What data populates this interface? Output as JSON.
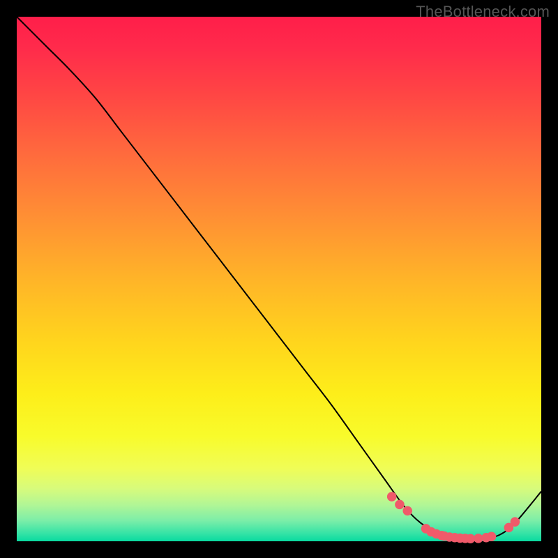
{
  "watermark": "TheBottleneck.com",
  "chart_data": {
    "type": "line",
    "title": "",
    "xlabel": "",
    "ylabel": "",
    "xlim": [
      0,
      100
    ],
    "ylim": [
      0,
      100
    ],
    "curve": {
      "x": [
        0,
        3,
        6,
        10,
        15,
        20,
        25,
        30,
        35,
        40,
        45,
        50,
        55,
        60,
        65,
        70,
        74,
        77,
        80,
        83,
        86,
        89,
        92,
        95,
        100
      ],
      "y": [
        100,
        97,
        94,
        90,
        84.5,
        78,
        71.5,
        65,
        58.5,
        52,
        45.5,
        39,
        32.5,
        26,
        19,
        12,
        6.5,
        3.5,
        1.8,
        0.9,
        0.5,
        0.5,
        1.2,
        3.5,
        9.5
      ]
    },
    "markers": {
      "x": [
        71.5,
        73,
        74.5,
        78,
        79,
        80,
        81,
        81.5,
        82.5,
        83.5,
        84.5,
        85.5,
        86.5,
        88,
        89.5,
        90.5,
        93.8,
        95
      ],
      "y": [
        8.5,
        7.0,
        5.8,
        2.4,
        1.8,
        1.4,
        1.1,
        1.0,
        0.8,
        0.7,
        0.6,
        0.55,
        0.5,
        0.55,
        0.7,
        0.9,
        2.6,
        3.7
      ]
    },
    "marker_color": "#f05a6a",
    "line_color": "#000000"
  }
}
